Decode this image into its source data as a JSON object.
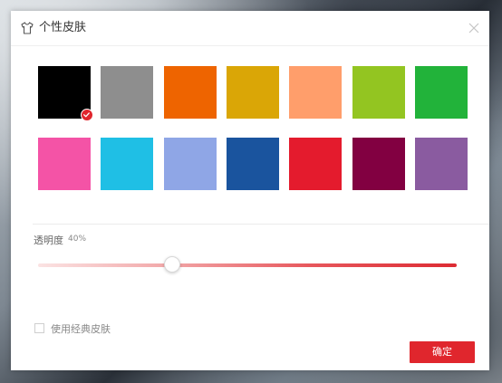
{
  "dialog": {
    "title": "个性皮肤",
    "title_icon": "tshirt-icon",
    "close_icon": "close-icon"
  },
  "skins": {
    "selected_index": 0,
    "colors": [
      "#000000",
      "#8e8e8e",
      "#ee6400",
      "#daa606",
      "#ff9e6b",
      "#93c521",
      "#22b33a",
      "#f453a6",
      "#1fbfe5",
      "#8fa6e6",
      "#1a549e",
      "#e41b2d",
      "#820041",
      "#8a5ba0"
    ]
  },
  "opacity": {
    "label": "透明度",
    "value_text": "40%",
    "value": 0.32
  },
  "classic_skin": {
    "label": "使用经典皮肤",
    "checked": false
  },
  "confirm_label": "确定",
  "accent_color": "#e0262d"
}
